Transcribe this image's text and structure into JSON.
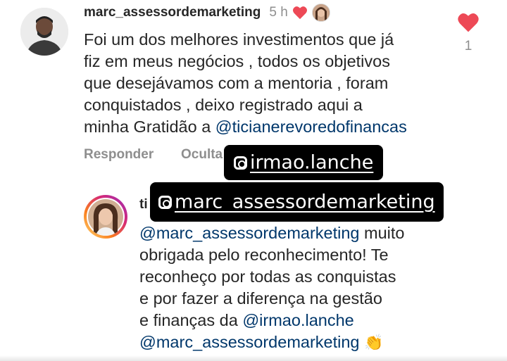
{
  "comment": {
    "username": "marc_assessordemarketing",
    "time": "5 h",
    "text_lines": [
      "Foi um dos melhores investimentos que já",
      "fiz em meus negócios , todos os objetivos",
      "que desejávamos com a mentoria , foram",
      "conquistados , deixo registrado aqui a"
    ],
    "last_line_prefix": "minha Gratidão a ",
    "mention": "@ticianerevoredofinancas",
    "like_count": "1",
    "reply_label": "Responder",
    "hide_label": "Oculta"
  },
  "reply": {
    "username_partial": "ti",
    "mention_start": "@marc_assessordemarketing",
    "first_line_rest": " muito",
    "lines": [
      "obrigada pelo reconhecimento! Te",
      "reconheço por todas as conquistas",
      "e por fazer a diferença na gestão"
    ],
    "line5_prefix": "e finanças da ",
    "line5_mention": "@irmao.lanche",
    "line6_mention": "@marc_assessordemarketing",
    "emoji": "👏"
  },
  "stickers": {
    "sticker1": "irmao.lanche",
    "sticker2": "marc_assessordemarketing"
  },
  "colors": {
    "heart": "#ed4956",
    "link": "#00376b",
    "muted": "#8e8e8e",
    "story_ring": "#d62976"
  },
  "icons": {
    "like_heart": "heart-icon",
    "mention_sticker": "at-icon"
  }
}
